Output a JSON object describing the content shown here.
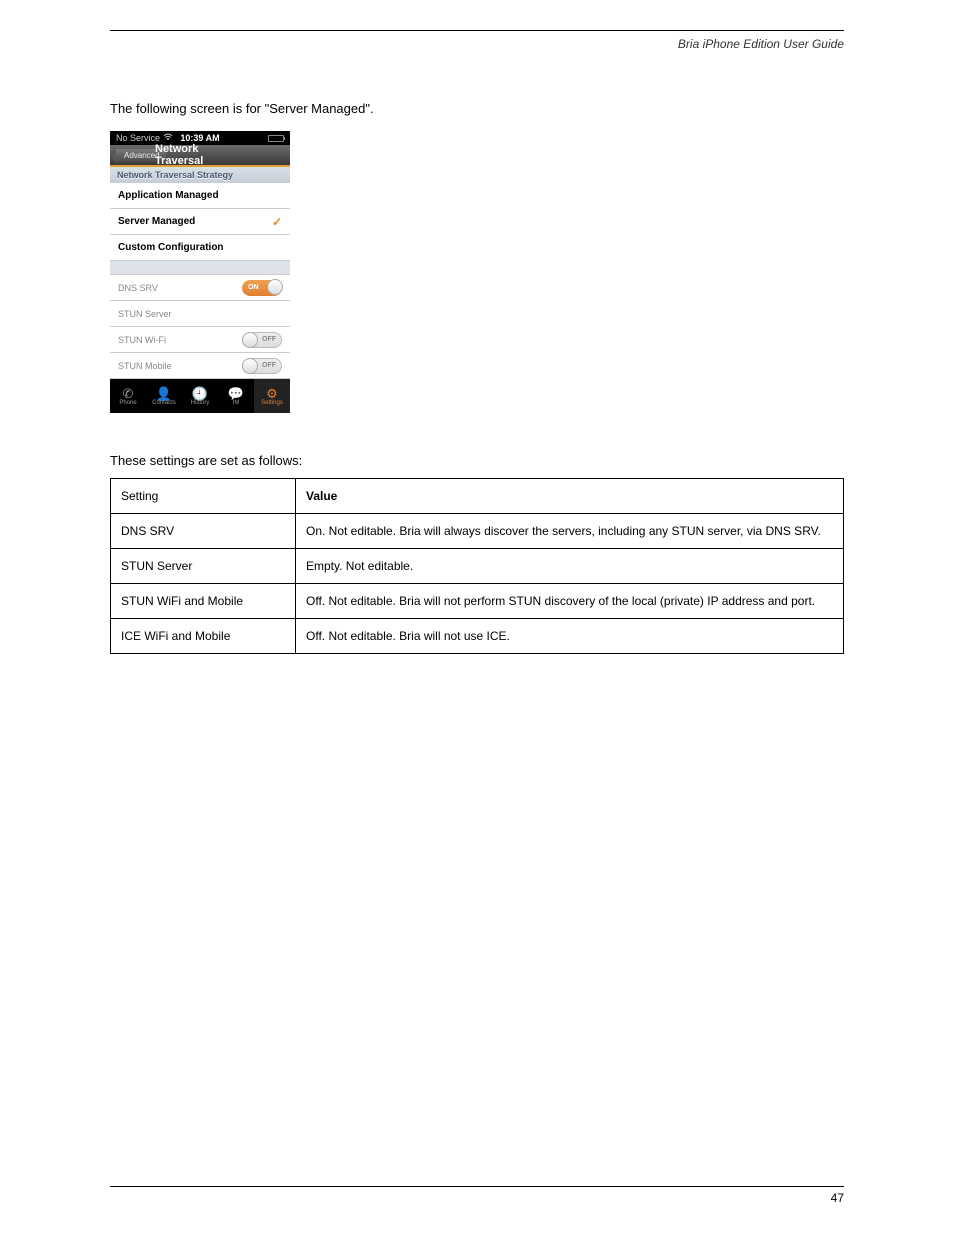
{
  "header": {
    "breadcrumb": "Bria iPhone Edition User Guide"
  },
  "intro": "The following screen is for \"Server Managed\".",
  "phone": {
    "status": {
      "service": "No Service",
      "time": "10:39 AM"
    },
    "nav": {
      "back": "Advanced",
      "title": "Network Traversal"
    },
    "section_header": "Network Traversal Strategy",
    "rows": {
      "app_managed": "Application Managed",
      "server_managed": "Server Managed",
      "custom_config": "Custom Configuration",
      "dns_srv": "DNS SRV",
      "stun_server": "STUN Server",
      "stun_wifi": "STUN Wi-Fi",
      "stun_mobile": "STUN Mobile"
    },
    "toggles": {
      "on": "ON",
      "off": "OFF"
    },
    "tabs": {
      "phone": "Phone",
      "contacts": "Contacts",
      "history": "History",
      "im": "IM",
      "settings": "Settings"
    }
  },
  "settings_title": "These settings are set as follows:",
  "table": {
    "head": {
      "setting": "Setting",
      "value": "Value"
    },
    "rows": [
      {
        "setting": "DNS SRV",
        "value": "On. Not editable. Bria will always discover the servers, including any STUN server, via DNS SRV."
      },
      {
        "setting": "STUN Server",
        "value": "Empty. Not editable."
      },
      {
        "setting": "STUN WiFi and Mobile",
        "value": "Off. Not editable. Bria will not perform STUN discovery of the local (private) IP address and port."
      },
      {
        "setting": "ICE WiFi and Mobile",
        "value": "Off. Not editable. Bria will not use ICE."
      }
    ]
  },
  "footer": {
    "page": "47"
  }
}
